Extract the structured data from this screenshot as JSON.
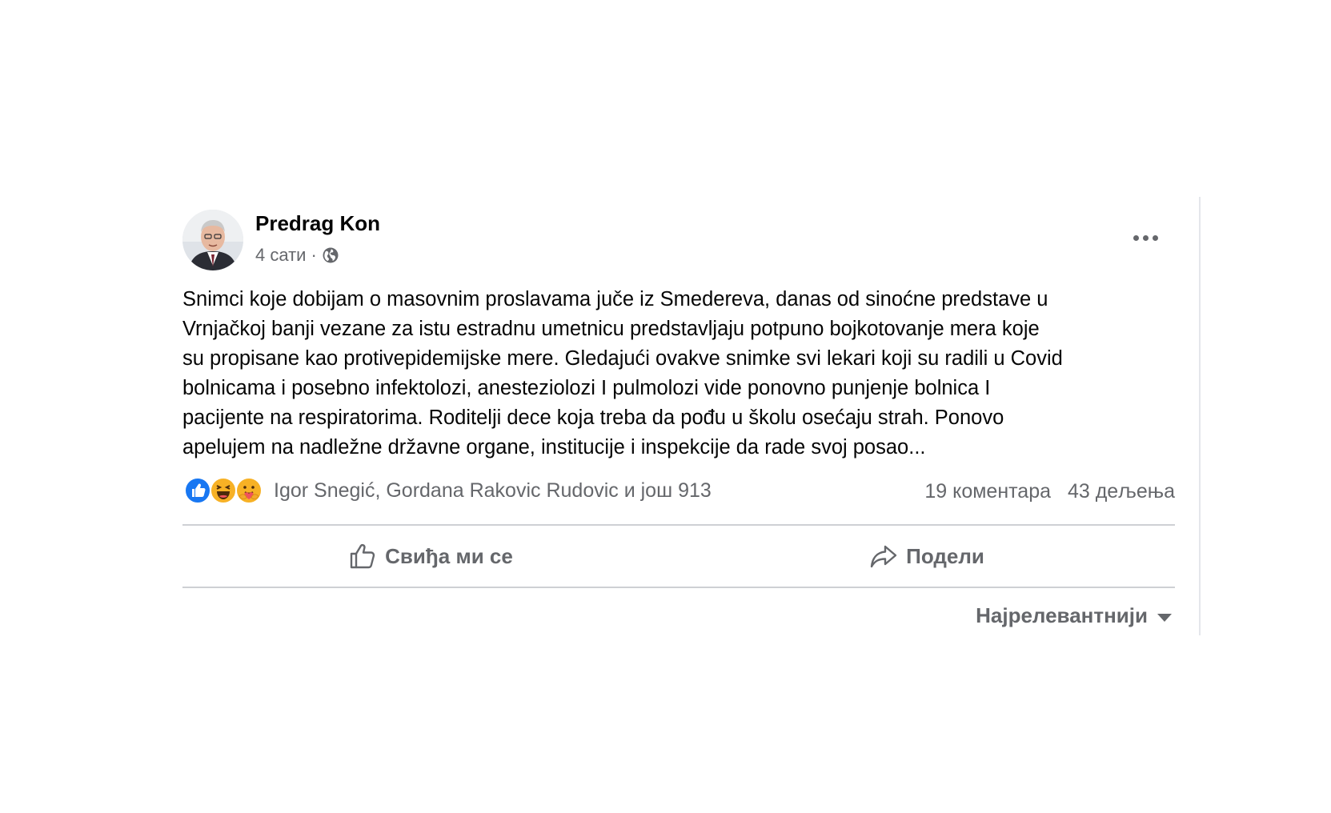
{
  "post": {
    "author": "Predrag Kon",
    "time": "4 сати",
    "separator": "·",
    "privacy_icon": "globe-icon",
    "more_icon": "more-options-icon",
    "body_lines": [
      "Snimci koje dobijam o masovnim proslavama juče iz Smedereva, danas od sinoćne predstave u",
      "Vrnjačkoj banji vezane za istu estradnu umetnicu predstavljaju potpuno bojkotovanje mera koje",
      "su propisane kao protivepidemijske mere. Gledajući ovakve snimke svi lekari koji su radili u Covid",
      "bolnicama i posebno infektolozi, anesteziolozi I pulmolozi vide ponovno punjenje bolnica I",
      "pacijente na respiratorima. Roditelji dece koja treba da pođu u školu osećaju strah. Ponovo",
      "apelujem na nadležne državne organe, institucije i inspekcije da rade svoj posao..."
    ]
  },
  "reactions": {
    "icons": [
      "like-reaction-icon",
      "haha-reaction-icon",
      "care-reaction-icon"
    ],
    "reactors_text": "Igor Snegić, Gordana Rakovic Rudovic и још 913",
    "comments": "19 коментара",
    "shares": "43 дељења"
  },
  "actions": {
    "like_label": "Свиђа ми се",
    "share_label": "Подели"
  },
  "sort": {
    "label": "Најрелевантнији"
  },
  "colors": {
    "text": "#050505",
    "secondary": "#65676b",
    "divider": "#ced0d4",
    "like_blue": "#1877f2",
    "haha_yellow": "#f7b125"
  }
}
